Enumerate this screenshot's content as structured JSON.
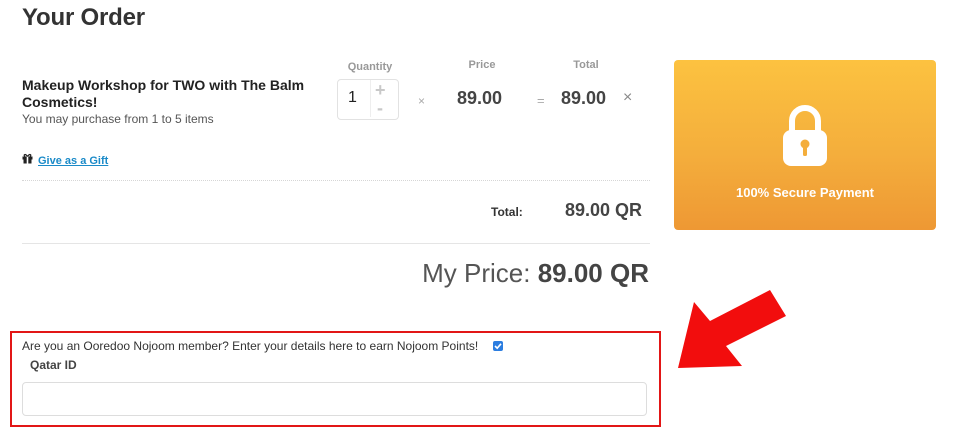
{
  "page": {
    "title": "Your Order"
  },
  "columns": {
    "quantity": "Quantity",
    "price": "Price",
    "total": "Total"
  },
  "item": {
    "name": "Makeup Workshop for TWO with The Balm Cosmetics!",
    "note": "You may purchase from 1 to 5 items",
    "quantity": "1",
    "plus": "+",
    "minus": "-",
    "times": "×",
    "equals": "=",
    "price": "89.00",
    "total": "89.00",
    "remove": "×",
    "gift_link": "Give as a Gift"
  },
  "summary": {
    "total_label": "Total:",
    "total_value": "89.00 QR",
    "my_price_label": "My Price:",
    "my_price_value": "89.00 QR"
  },
  "secure_payment": {
    "text": "100% Secure Payment",
    "color": "#f4ae3c"
  },
  "nojoom": {
    "prompt": "Are you an Ooredoo Nojoom member? Enter your details here to earn Nojoom Points!",
    "checked": true,
    "id_label": "Qatar ID",
    "id_value": ""
  },
  "annotation": {
    "highlight_color": "#e21616",
    "icon": "red-arrow-icon"
  },
  "icons": [
    "gift-icon",
    "lock-icon",
    "checkbox-checked-icon",
    "close-icon",
    "plus-icon",
    "minus-icon"
  ]
}
